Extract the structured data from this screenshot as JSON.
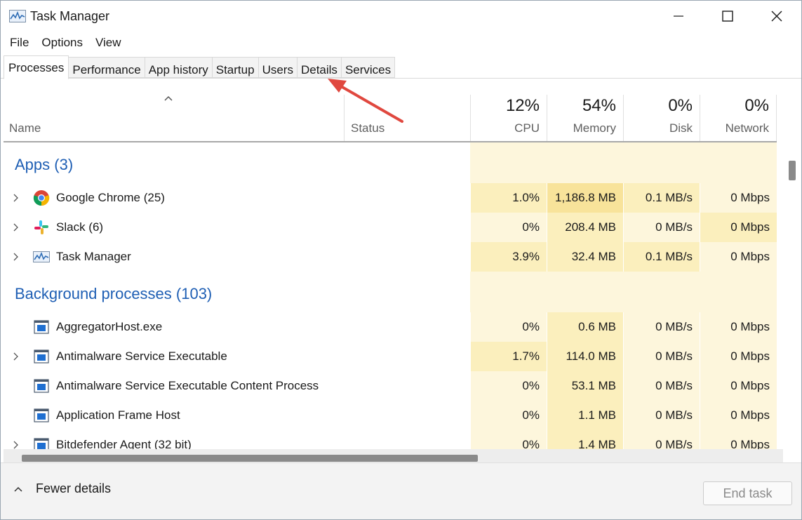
{
  "window": {
    "title": "Task Manager"
  },
  "menu": [
    "File",
    "Options",
    "View"
  ],
  "tabs": [
    "Processes",
    "Performance",
    "App history",
    "Startup",
    "Users",
    "Details",
    "Services"
  ],
  "active_tab": "Processes",
  "columns": {
    "name": "Name",
    "status": "Status",
    "cpu": {
      "label": "CPU",
      "total": "12%"
    },
    "memory": {
      "label": "Memory",
      "total": "54%"
    },
    "disk": {
      "label": "Disk",
      "total": "0%"
    },
    "network": {
      "label": "Network",
      "total": "0%"
    }
  },
  "groups": {
    "apps": "Apps (3)",
    "background": "Background processes (103)"
  },
  "apps": [
    {
      "name": "Google Chrome (25)",
      "icon": "chrome-icon",
      "cpu": "1.0%",
      "memory": "1,186.8 MB",
      "disk": "0.1 MB/s",
      "network": "0 Mbps",
      "expandable": true
    },
    {
      "name": "Slack (6)",
      "icon": "slack-icon",
      "cpu": "0%",
      "memory": "208.4 MB",
      "disk": "0 MB/s",
      "network": "0 Mbps",
      "expandable": true
    },
    {
      "name": "Task Manager",
      "icon": "task-manager-icon",
      "cpu": "3.9%",
      "memory": "32.4 MB",
      "disk": "0.1 MB/s",
      "network": "0 Mbps",
      "expandable": true
    }
  ],
  "background": [
    {
      "name": "AggregatorHost.exe",
      "icon": "process-icon",
      "cpu": "0%",
      "memory": "0.6 MB",
      "disk": "0 MB/s",
      "network": "0 Mbps",
      "expandable": false
    },
    {
      "name": "Antimalware Service Executable",
      "icon": "process-icon",
      "cpu": "1.7%",
      "memory": "114.0 MB",
      "disk": "0 MB/s",
      "network": "0 Mbps",
      "expandable": true
    },
    {
      "name": "Antimalware Service Executable Content Process",
      "icon": "process-icon",
      "cpu": "0%",
      "memory": "53.1 MB",
      "disk": "0 MB/s",
      "network": "0 Mbps",
      "expandable": false
    },
    {
      "name": "Application Frame Host",
      "icon": "process-icon",
      "cpu": "0%",
      "memory": "1.1 MB",
      "disk": "0 MB/s",
      "network": "0 Mbps",
      "expandable": false
    },
    {
      "name": "Bitdefender Agent (32 bit)",
      "icon": "process-icon",
      "cpu": "0%",
      "memory": "1.4 MB",
      "disk": "0 MB/s",
      "network": "0 Mbps",
      "expandable": true
    }
  ],
  "footer": {
    "fewer_details": "Fewer details",
    "end_task": "End task"
  },
  "colors": {
    "group_title": "#1f5fb4",
    "heat_light": "#fdf6dc",
    "heat_mid": "#fbefbd",
    "heat_strong": "#f8e39a",
    "annotation_arrow": "#e0483f"
  }
}
